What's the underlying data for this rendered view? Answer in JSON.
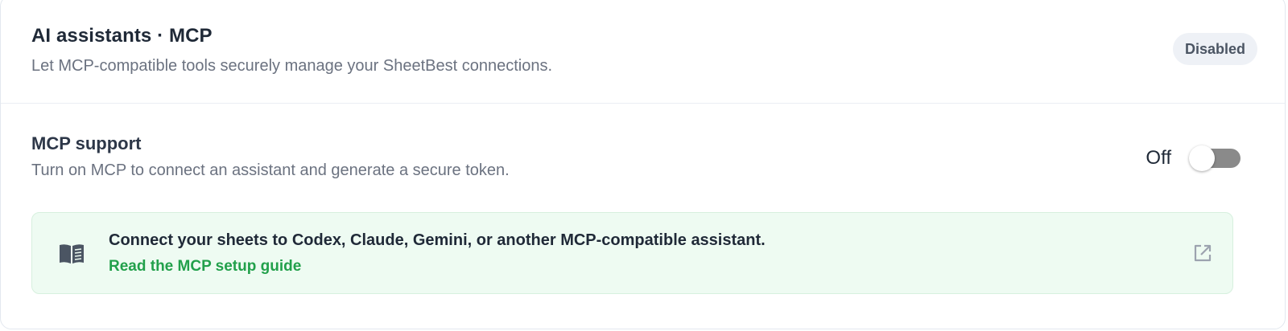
{
  "header": {
    "title": "AI assistants · MCP",
    "description": "Let MCP-compatible tools securely manage your SheetBest connections.",
    "status_badge": "Disabled"
  },
  "mcp_setting": {
    "title": "MCP support",
    "description": "Turn on MCP to connect an assistant and generate a secure token.",
    "toggle_label": "Off",
    "toggle_on": false
  },
  "callout": {
    "icon": "book-icon",
    "text": "Connect your sheets to Codex, Claude, Gemini, or another MCP-compatible assistant.",
    "link_label": "Read the MCP setup guide",
    "link_icon": "external-link-icon"
  },
  "colors": {
    "accent_green": "#22a04b",
    "callout_bg": "#eefbf2",
    "toggle_off": "#8a8a8a"
  }
}
